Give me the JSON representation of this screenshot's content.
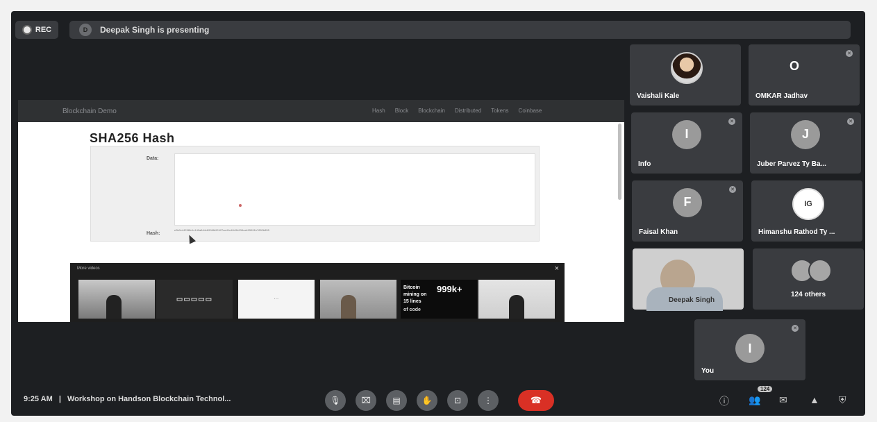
{
  "topbar": {
    "rec_label": "REC",
    "presenter_icon_letter": "D",
    "presenting_text": "Deepak Singh is presenting"
  },
  "share": {
    "brand": "Blockchain Demo",
    "nav_links": [
      "Hash",
      "Block",
      "Blockchain",
      "Distributed",
      "Tokens",
      "Coinbase"
    ],
    "title": "SHA256 Hash",
    "data_label": "Data:",
    "hash_label": "Hash:",
    "hash_value": "e3b0c44298fc1c149afbf4c8996fb92427ae41e4649b934ca495991b7852b855",
    "videos_header": "More videos",
    "thumbs": {
      "t5_big": "999k+",
      "t5_l1": "Bitcoin",
      "t5_l2": "mining on",
      "t5_l3": "15 lines",
      "t5_l4": "of code"
    }
  },
  "participants": [
    {
      "name": "Vaishali Kale",
      "initial": ""
    },
    {
      "name": "OMKAR Jadhav",
      "initial": "O"
    },
    {
      "name": "Info",
      "initial": "I"
    },
    {
      "name": "Juber Parvez Ty Ba...",
      "initial": "J"
    },
    {
      "name": "Faisal Khan",
      "initial": "F"
    },
    {
      "name": "Himanshu Rathod Ty ...",
      "initial": "IG"
    },
    {
      "name": "Deepak Singh",
      "initial": ""
    },
    {
      "name": "124 others",
      "initial": ""
    },
    {
      "name": "You",
      "initial": "I"
    }
  ],
  "bottombar": {
    "time": "9:25 AM",
    "separator": "|",
    "meeting_title": "Workshop on Handson Blockchain Technol...",
    "chat_badge": "124"
  },
  "colors": {
    "background": "#1d1f22",
    "tile": "#3a3c40",
    "end_call": "#d93025"
  }
}
